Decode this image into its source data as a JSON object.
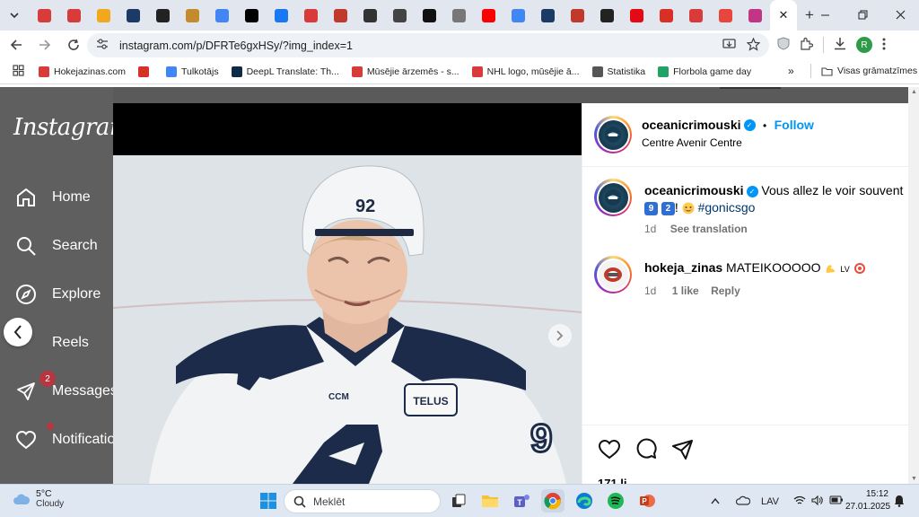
{
  "browser": {
    "active_tab_close": "✕",
    "new_tab": "+",
    "tabs": [
      {
        "icon": "hokejazinas-icon",
        "color": "#d93a3a"
      },
      {
        "icon": "hokejazinas-icon",
        "color": "#d93a3a"
      },
      {
        "icon": "sz-icon",
        "color": "#f2a81d"
      },
      {
        "icon": "p-icon",
        "color": "#1c3a66"
      },
      {
        "icon": "c-icon",
        "color": "#222222"
      },
      {
        "icon": "hockey-icon",
        "color": "#c28b2c"
      },
      {
        "icon": "google-icon",
        "color": "#4285f4"
      },
      {
        "icon": "x-icon",
        "color": "#000000"
      },
      {
        "icon": "facebook-icon",
        "color": "#1877f2"
      },
      {
        "icon": "hokejazinas-icon",
        "color": "#d93a3a"
      },
      {
        "icon": "b-icon",
        "color": "#c0392b"
      },
      {
        "icon": "g-icon",
        "color": "#333333"
      },
      {
        "icon": "m-icon",
        "color": "#444444"
      },
      {
        "icon": "ff-icon",
        "color": "#111111"
      },
      {
        "icon": "nhl-icon",
        "color": "#777777"
      },
      {
        "icon": "youtube-icon",
        "color": "#ff0000"
      },
      {
        "icon": "translate-icon",
        "color": "#4285f4"
      },
      {
        "icon": "p-icon",
        "color": "#1c3a66"
      },
      {
        "icon": "dots-icon",
        "color": "#c0392b"
      },
      {
        "icon": "go-icon",
        "color": "#222222"
      },
      {
        "icon": "netflix-icon",
        "color": "#e50914"
      },
      {
        "icon": "gmail-icon",
        "color": "#d93025"
      },
      {
        "icon": "cc-icon",
        "color": "#d93a3a"
      },
      {
        "icon": "a-icon",
        "color": "#e8453c"
      },
      {
        "icon": "instagram-icon",
        "color": "#c13584"
      }
    ],
    "url": "instagram.com/p/DFRTe6gxHSy/?img_index=1",
    "profile_initial": "R",
    "bookmarks": [
      {
        "label": "Hokejazinas.com",
        "color": "#d93a3a"
      },
      {
        "label": "",
        "color": "#d93025"
      },
      {
        "label": "Tulkotājs",
        "color": "#4285f4"
      },
      {
        "label": "DeepL Translate: Th...",
        "color": "#0f2b46"
      },
      {
        "label": "Mūsējie ārzemēs - s...",
        "color": "#d93a3a"
      },
      {
        "label": "NHL logo, mūsējie ā...",
        "color": "#d93a3a"
      },
      {
        "label": "Statistika",
        "color": "#555555"
      },
      {
        "label": "Florbola game day",
        "color": "#21a366"
      }
    ],
    "bookmarks_more": "»",
    "all_bookmarks": "Visas grāmatzīmes"
  },
  "instagram": {
    "logo": "Instagram",
    "nav": [
      {
        "label": "Home",
        "icon": "home-icon"
      },
      {
        "label": "Search",
        "icon": "search-icon"
      },
      {
        "label": "Explore",
        "icon": "explore-icon"
      },
      {
        "label": "Reels",
        "icon": "reels-icon"
      },
      {
        "label": "Messages",
        "icon": "messages-icon",
        "badge": "2"
      },
      {
        "label": "Notifications",
        "icon": "heart-icon"
      }
    ],
    "post": {
      "username": "oceanicrimouski",
      "follow": "Follow",
      "separator": "•",
      "location": "Centre Avenir Centre",
      "caption": {
        "username": "oceanicrimouski",
        "text": "Vous allez le voir souvent",
        "emoji_9": "9",
        "emoji_2": "2",
        "excl": "!",
        "hashtag": "#gonicsgo",
        "time": "1d",
        "translate": "See translation"
      },
      "comment": {
        "username": "hokeja_zinas",
        "text": "MATEIKOOOOO",
        "suffix": "LV",
        "time": "1d",
        "likes": "1 like",
        "reply": "Reply"
      },
      "likes_partial": "171 li"
    },
    "jersey_number": "92"
  },
  "taskbar": {
    "temp": "5°C",
    "condition": "Cloudy",
    "search_placeholder": "Meklēt",
    "lang": "LAV",
    "time": "15:12",
    "date": "27.01.2025"
  }
}
